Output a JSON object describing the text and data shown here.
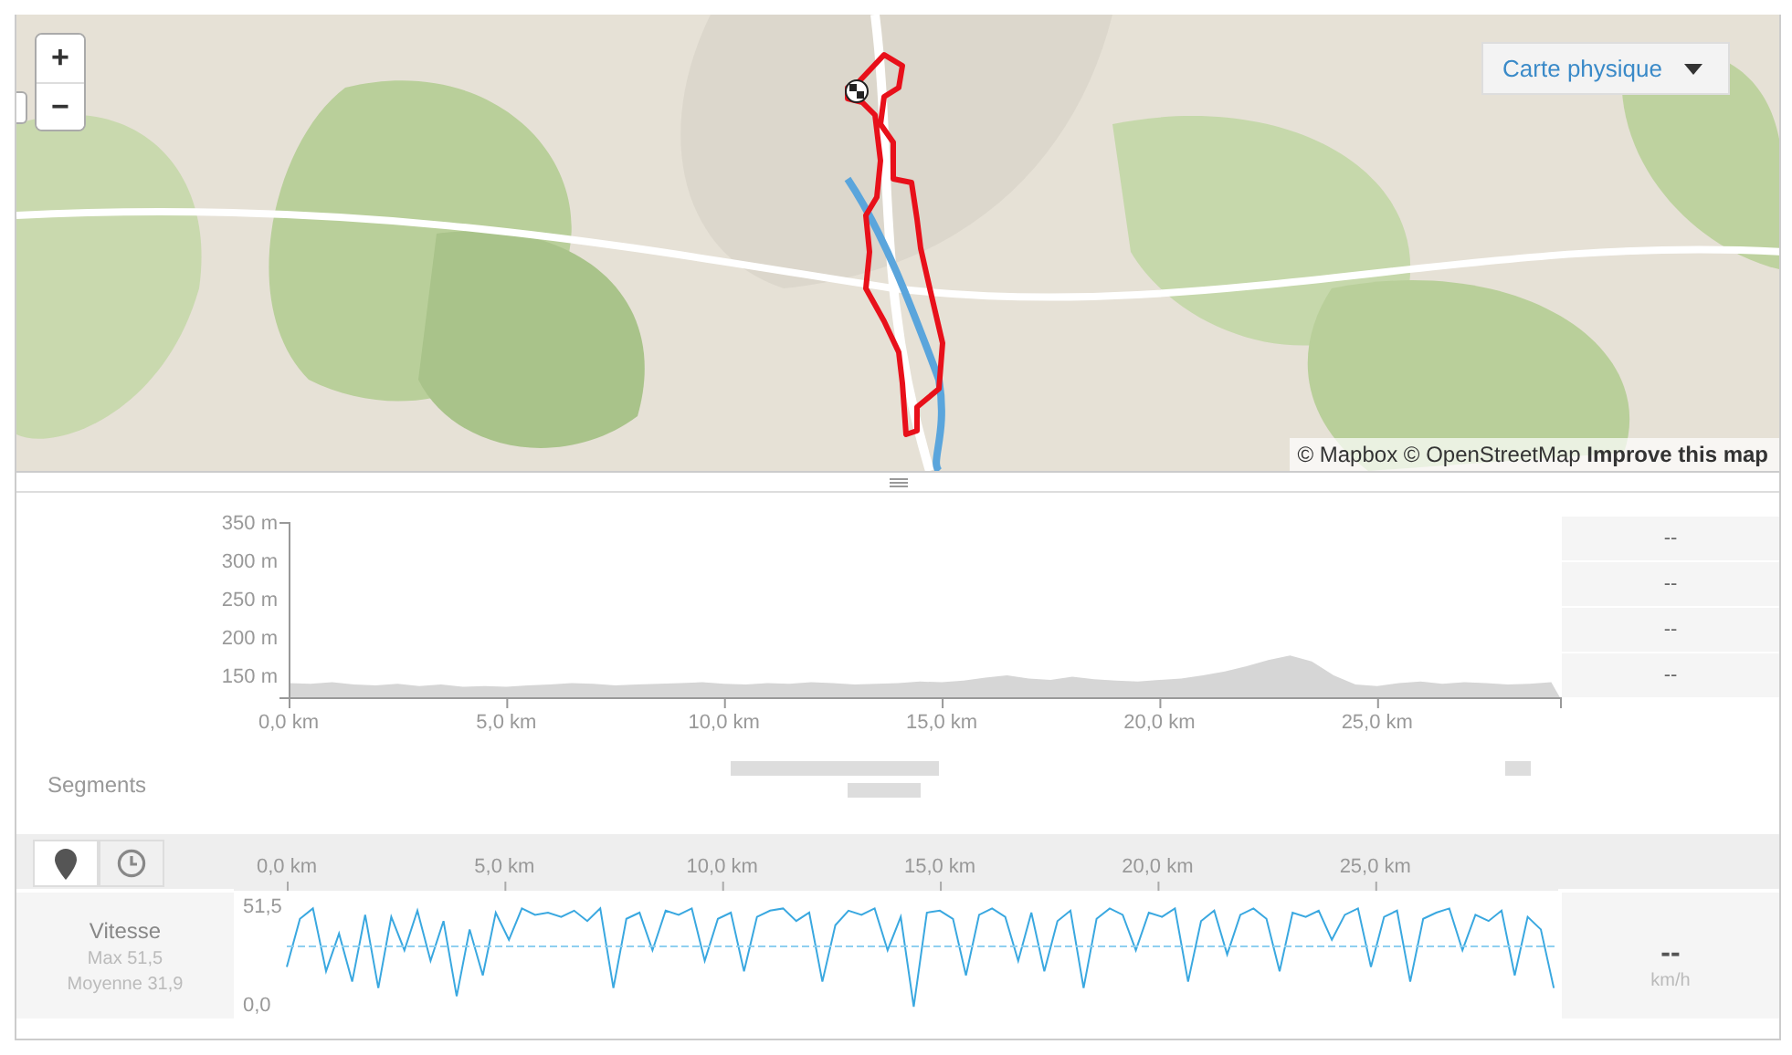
{
  "map": {
    "zoom_in": "+",
    "zoom_out": "−",
    "layer_select": "Carte physique",
    "attribution": {
      "text": "© Mapbox © OpenStreetMap",
      "link": "Improve this map"
    }
  },
  "elevation": {
    "stats": [
      "--",
      "--",
      "--",
      "--"
    ],
    "chart_data": {
      "type": "area",
      "xlim": [
        0,
        29.2
      ],
      "ylim": [
        121,
        350
      ],
      "yticks": [
        {
          "value": 150,
          "label": "150 m"
        },
        {
          "value": 200,
          "label": "200 m"
        },
        {
          "value": 250,
          "label": "250 m"
        },
        {
          "value": 300,
          "label": "300 m"
        },
        {
          "value": 350,
          "label": "350 m"
        }
      ],
      "xticks": [
        {
          "value": 0,
          "label": "0,0 km"
        },
        {
          "value": 5,
          "label": "5,0 km"
        },
        {
          "value": 10,
          "label": "10,0 km"
        },
        {
          "value": 15,
          "label": "15,0 km"
        },
        {
          "value": 20,
          "label": "20,0 km"
        },
        {
          "value": 25,
          "label": "25,0 km"
        }
      ],
      "x": [
        0,
        0.5,
        1,
        1.5,
        2,
        2.5,
        3,
        3.5,
        4,
        4.5,
        5,
        5.5,
        6,
        6.5,
        7,
        7.5,
        8,
        8.5,
        9,
        9.5,
        10,
        10.5,
        11,
        11.5,
        12,
        12.5,
        13,
        13.5,
        14,
        14.5,
        15,
        15.5,
        16,
        16.5,
        17,
        17.5,
        18,
        18.5,
        19,
        19.5,
        20,
        20.5,
        21,
        21.5,
        22,
        22.5,
        23,
        23.5,
        24,
        24.5,
        25,
        25.5,
        26,
        26.5,
        27,
        27.5,
        28,
        28.5,
        29
      ],
      "series": [
        {
          "color": "#d6d6d6",
          "values": [
            140,
            139,
            141,
            138,
            137,
            139,
            136,
            138,
            135,
            136,
            135,
            137,
            138,
            140,
            139,
            137,
            138,
            139,
            140,
            141,
            139,
            138,
            140,
            139,
            141,
            140,
            138,
            139,
            140,
            142,
            141,
            143,
            147,
            150,
            146,
            144,
            148,
            145,
            143,
            142,
            144,
            146,
            150,
            155,
            162,
            170,
            176,
            168,
            150,
            138,
            136,
            140,
            142,
            139,
            141,
            140,
            138,
            139,
            141
          ]
        }
      ]
    }
  },
  "segments": {
    "label": "Segments"
  },
  "view_toggles": [
    {
      "kind": "distance",
      "selected": true
    },
    {
      "kind": "time",
      "selected": false
    }
  ],
  "speed": {
    "label": "Vitesse",
    "max": "Max 51,5",
    "average": "Moyenne 31,9",
    "reading": "--",
    "unit": "km/h",
    "chart_data": {
      "type": "line",
      "xlim": [
        0,
        29.2
      ],
      "ylim": [
        0,
        51.5
      ],
      "yticks": [
        {
          "value": 0,
          "label": "0,0"
        },
        {
          "value": 51.5,
          "label": "51,5"
        }
      ],
      "xticks": [
        {
          "value": 0,
          "label": "0,0 km"
        },
        {
          "value": 5,
          "label": "5,0 km"
        },
        {
          "value": 10,
          "label": "10,0 km"
        },
        {
          "value": 15,
          "label": "15,0 km"
        },
        {
          "value": 20,
          "label": "20,0 km"
        },
        {
          "value": 25,
          "label": "25,0 km"
        }
      ],
      "ref_lines": [
        {
          "value": 31.9,
          "axis": "y"
        }
      ],
      "x": [
        0,
        0.3,
        0.6,
        0.9,
        1.2,
        1.5,
        1.8,
        2.1,
        2.4,
        2.7,
        3,
        3.3,
        3.6,
        3.9,
        4.2,
        4.5,
        4.8,
        5.1,
        5.4,
        5.7,
        6,
        6.3,
        6.6,
        6.9,
        7.2,
        7.5,
        7.8,
        8.1,
        8.4,
        8.7,
        9,
        9.3,
        9.6,
        9.9,
        10.2,
        10.5,
        10.8,
        11.1,
        11.4,
        11.7,
        12,
        12.3,
        12.6,
        12.9,
        13.2,
        13.5,
        13.8,
        14.1,
        14.4,
        14.7,
        15,
        15.3,
        15.6,
        15.9,
        16.2,
        16.5,
        16.8,
        17.1,
        17.4,
        17.7,
        18,
        18.3,
        18.6,
        18.9,
        19.2,
        19.5,
        19.8,
        20.1,
        20.4,
        20.7,
        21,
        21.3,
        21.6,
        21.9,
        22.2,
        22.5,
        22.8,
        23.1,
        23.4,
        23.7,
        24,
        24.3,
        24.6,
        24.9,
        25.2,
        25.5,
        25.8,
        26.1,
        26.4,
        26.7,
        27,
        27.3,
        27.6,
        27.9,
        28.2,
        28.5,
        28.8,
        29.1
      ],
      "series": [
        {
          "color": "#3aa8e0",
          "values": [
            22,
            45,
            50,
            20,
            38,
            15,
            47,
            12,
            46,
            30,
            49,
            25,
            44,
            8,
            40,
            18,
            48,
            35,
            50,
            47,
            48,
            46,
            49,
            44,
            50,
            12,
            45,
            48,
            30,
            49,
            47,
            50,
            25,
            45,
            48,
            20,
            46,
            49,
            50,
            44,
            48,
            15,
            42,
            49,
            47,
            50,
            30,
            46,
            3,
            48,
            49,
            45,
            18,
            47,
            50,
            46,
            25,
            48,
            20,
            44,
            49,
            12,
            45,
            50,
            47,
            30,
            48,
            46,
            50,
            15,
            44,
            49,
            28,
            47,
            50,
            45,
            20,
            48,
            46,
            49,
            35,
            47,
            50,
            22,
            46,
            49,
            15,
            45,
            48,
            50,
            30,
            47,
            44,
            49,
            18,
            46,
            40,
            12
          ]
        }
      ]
    }
  }
}
